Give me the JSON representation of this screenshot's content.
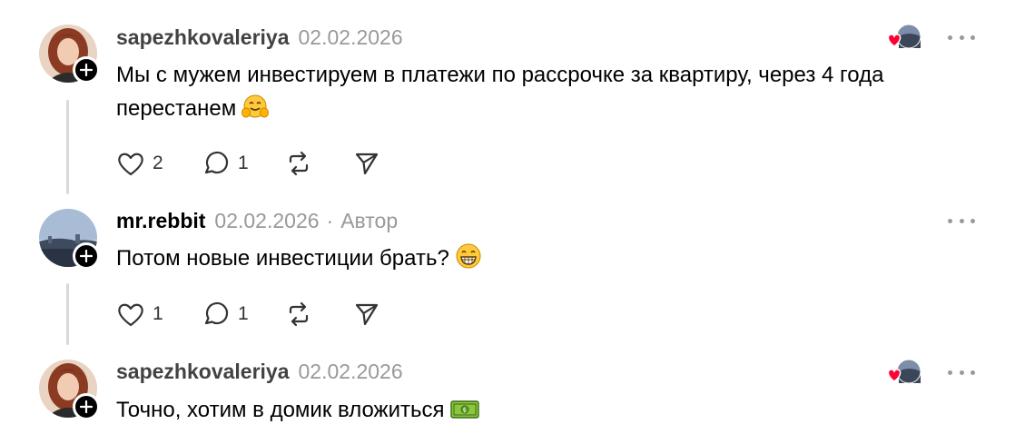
{
  "posts": [
    {
      "username": "sapezhkovaleriya",
      "date": "02.02.2026",
      "text": "Мы с мужем инвестируем в платежи по рассрочке за квартиру, через 4 года перестанем",
      "emoji": "hugging-face-emoji",
      "liked_by_author": true,
      "likes": "2",
      "replies": "1"
    },
    {
      "username": "mr.rebbit",
      "date": "02.02.2026",
      "separator": "·",
      "author_label": "Автор",
      "text": "Потом новые инвестиции брать?",
      "emoji": "grinning-face-emoji",
      "likes": "1",
      "replies": "1"
    },
    {
      "username": "sapezhkovaleriya",
      "date": "02.02.2026",
      "text": "Точно, хотим в домик вложиться",
      "emoji": "dollar-banknote-emoji",
      "liked_by_author": true
    }
  ],
  "colors": {
    "text": "#000000",
    "muted": "#999999",
    "heart": "#ff0033",
    "thread_line": "#d9d9d9"
  }
}
